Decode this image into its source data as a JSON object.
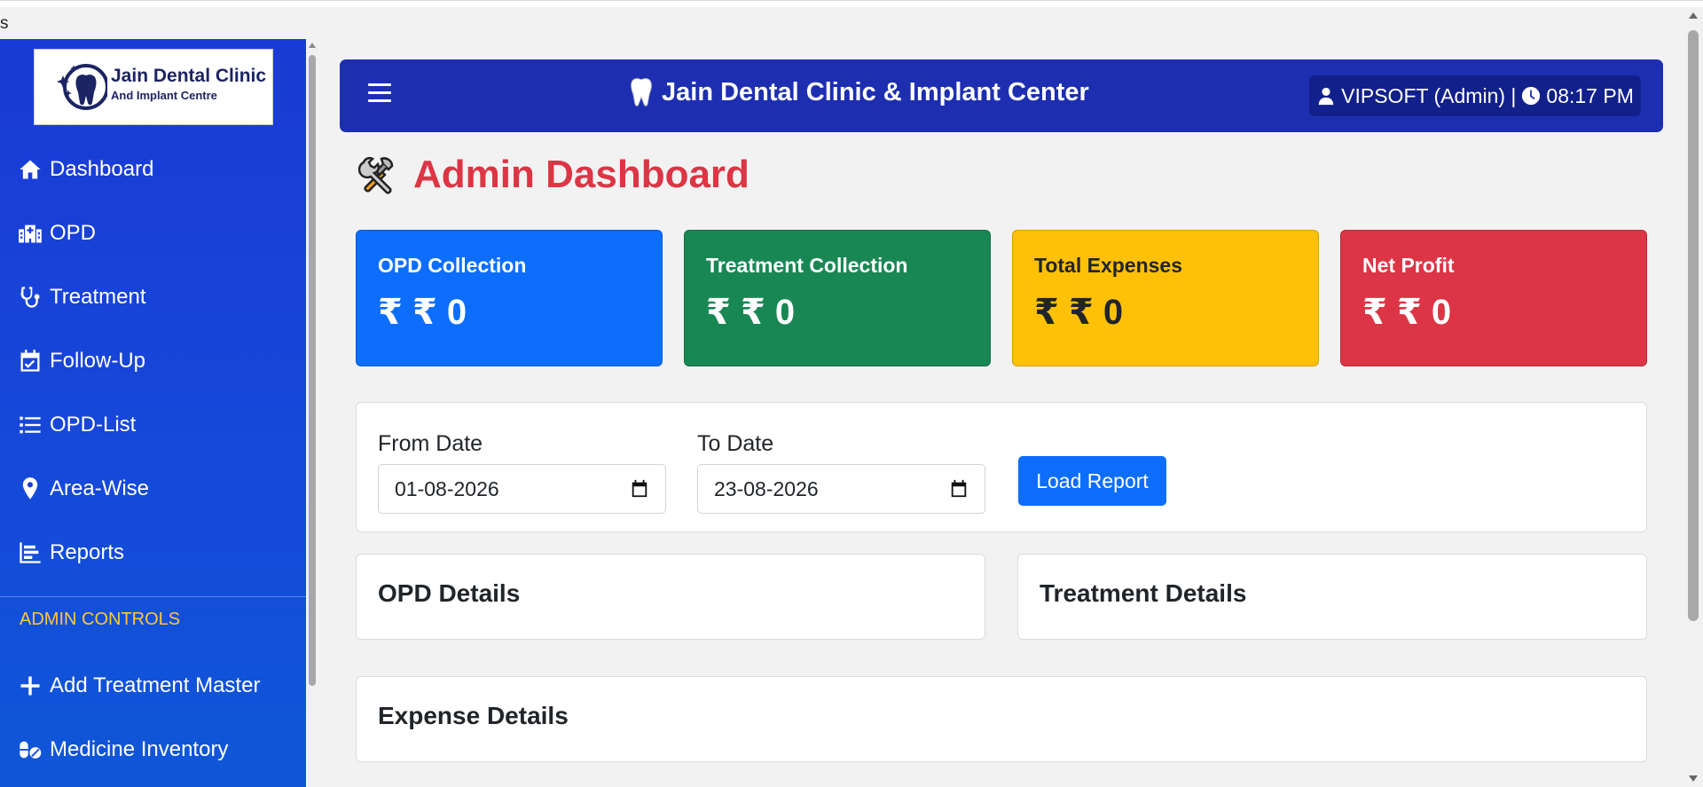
{
  "stray_text": "s",
  "sidebar": {
    "logo": {
      "title": "Jain Dental Clinic",
      "subtitle": "And Implant Centre"
    },
    "items": [
      {
        "label": "Dashboard",
        "icon": "home-icon"
      },
      {
        "label": "OPD",
        "icon": "hospital-icon"
      },
      {
        "label": "Treatment",
        "icon": "stethoscope-icon"
      },
      {
        "label": "Follow-Up",
        "icon": "calendar-check-icon"
      },
      {
        "label": "OPD-List",
        "icon": "list-icon"
      },
      {
        "label": "Area-Wise",
        "icon": "map-pin-icon"
      },
      {
        "label": "Reports",
        "icon": "chart-icon"
      }
    ],
    "section_label": "ADMIN CONTROLS",
    "admin_items": [
      {
        "label": "Add Treatment Master",
        "icon": "plus-icon"
      },
      {
        "label": "Medicine Inventory",
        "icon": "pills-icon"
      }
    ]
  },
  "header": {
    "title": "Jain Dental Clinic & Implant Center",
    "user": "VIPSOFT (Admin) |",
    "time": "08:17 PM"
  },
  "page": {
    "title": "Admin Dashboard"
  },
  "cards": [
    {
      "label": "OPD Collection",
      "value": "₹ ₹ 0"
    },
    {
      "label": "Treatment Collection",
      "value": "₹ ₹ 0"
    },
    {
      "label": "Total Expenses",
      "value": "₹ ₹ 0"
    },
    {
      "label": "Net Profit",
      "value": "₹ ₹ 0"
    }
  ],
  "filter": {
    "from_label": "From Date",
    "from_value": "01-08-2026",
    "to_label": "To Date",
    "to_value": "23-08-2026",
    "button": "Load Report"
  },
  "panels": {
    "opd": "OPD Details",
    "treatment": "Treatment Details",
    "expense": "Expense Details"
  },
  "colors": {
    "sidebar": "#1a3ad6",
    "header": "#1d2fb0",
    "title_red": "#dc3545",
    "primary": "#0d6efd",
    "success": "#198754",
    "warning": "#ffc107",
    "danger": "#dc3545",
    "section_label": "#ffc63d"
  }
}
